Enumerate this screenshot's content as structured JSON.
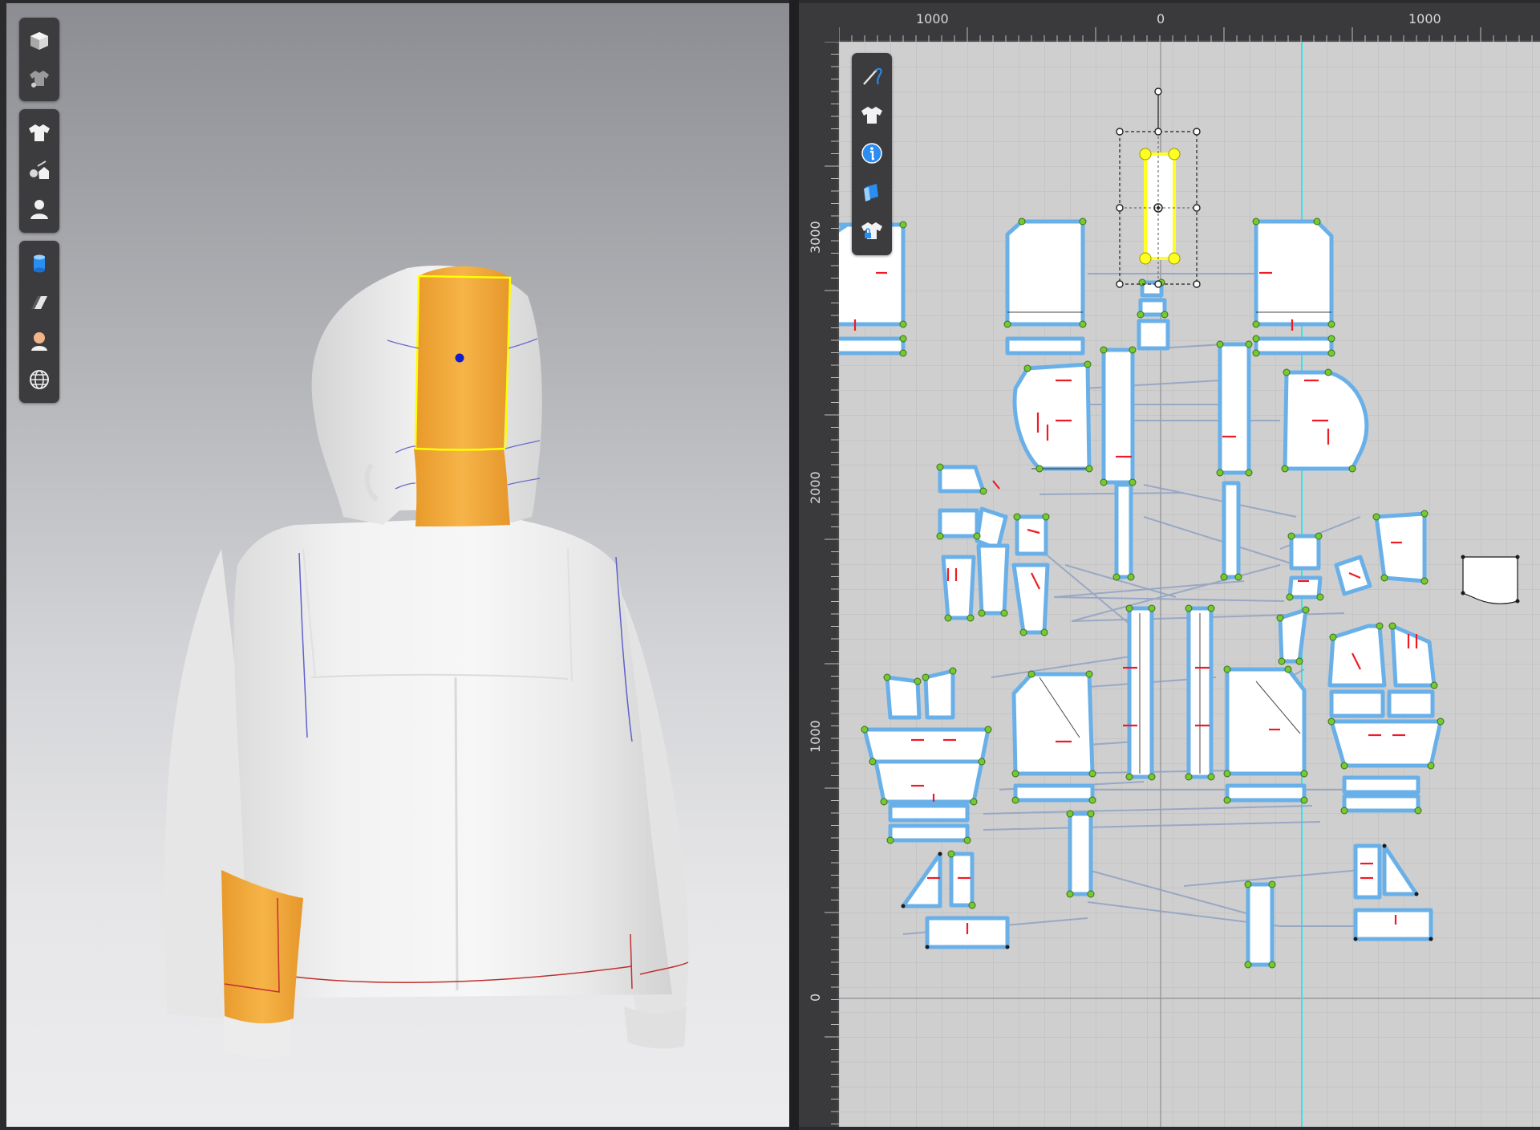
{
  "viewport3d": {
    "toolbar_groups": [
      {
        "icons": [
          "cube-view-icon",
          "garment-display-icon"
        ]
      },
      {
        "icons": [
          "shirt-icon",
          "fabric-tool-icon",
          "avatar-icon"
        ]
      },
      {
        "icons": [
          "cylinder-shape-icon",
          "texture-icon",
          "skin-icon",
          "globe-icon"
        ]
      }
    ],
    "colors": {
      "selected_piece": "#f4a833",
      "selection_outline": "#ffff00",
      "pin": "#1020c8",
      "garment": "#f3f3f3"
    }
  },
  "pattern_window": {
    "ruler": {
      "top_labels": [
        "1000",
        "0",
        "1000"
      ],
      "left_labels": [
        "3000",
        "2000",
        "1000",
        "0"
      ]
    },
    "toolbar_icons": [
      "sewing-needle-icon",
      "shirt-icon",
      "info-icon",
      "layer-icon",
      "lock-shirt-icon"
    ],
    "colors": {
      "grid_bg": "#cfcfd0",
      "piece_outline": "#6ab0e8",
      "point": "#78c832",
      "sewing_line": "#8c9fc0",
      "notch": "#ee1b24",
      "center_guide": "#30e5ea",
      "selected": "#ffff22"
    }
  }
}
